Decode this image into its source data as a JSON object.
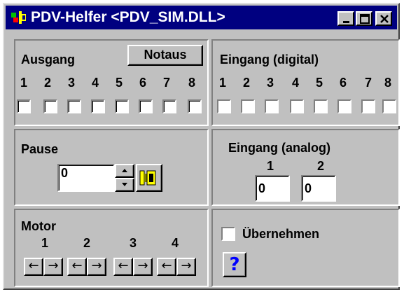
{
  "window": {
    "title": "PDV-Helfer <PDV_SIM.DLL>",
    "title_color": "#000080",
    "controls": [
      "minimize-icon",
      "maximize-icon",
      "close-icon"
    ]
  },
  "ausgang": {
    "label": "Ausgang",
    "notaus_label": "Notaus",
    "numbers": [
      "1",
      "2",
      "3",
      "4",
      "5",
      "6",
      "7",
      "8"
    ],
    "checked": [
      false,
      false,
      false,
      false,
      false,
      false,
      false,
      false
    ]
  },
  "eingang_digital": {
    "label": "Eingang (digital)",
    "numbers": [
      "1",
      "2",
      "3",
      "4",
      "5",
      "6",
      "7",
      "8"
    ],
    "checked": [
      false,
      false,
      false,
      false,
      false,
      false,
      false,
      false
    ]
  },
  "pause": {
    "label": "Pause",
    "value": "0",
    "icon": "execute-icon"
  },
  "eingang_analog": {
    "label": "Eingang (analog)",
    "channels": [
      {
        "number": "1",
        "value": "0"
      },
      {
        "number": "2",
        "value": "0"
      }
    ]
  },
  "motor": {
    "label": "Motor",
    "numbers": [
      "1",
      "2",
      "3",
      "4"
    ],
    "left_glyph": "←",
    "right_glyph": "→"
  },
  "options": {
    "uebernehmen_label": "Übernehmen",
    "uebernehmen_checked": false,
    "help_glyph": "?",
    "help_color": "#0000ff"
  }
}
